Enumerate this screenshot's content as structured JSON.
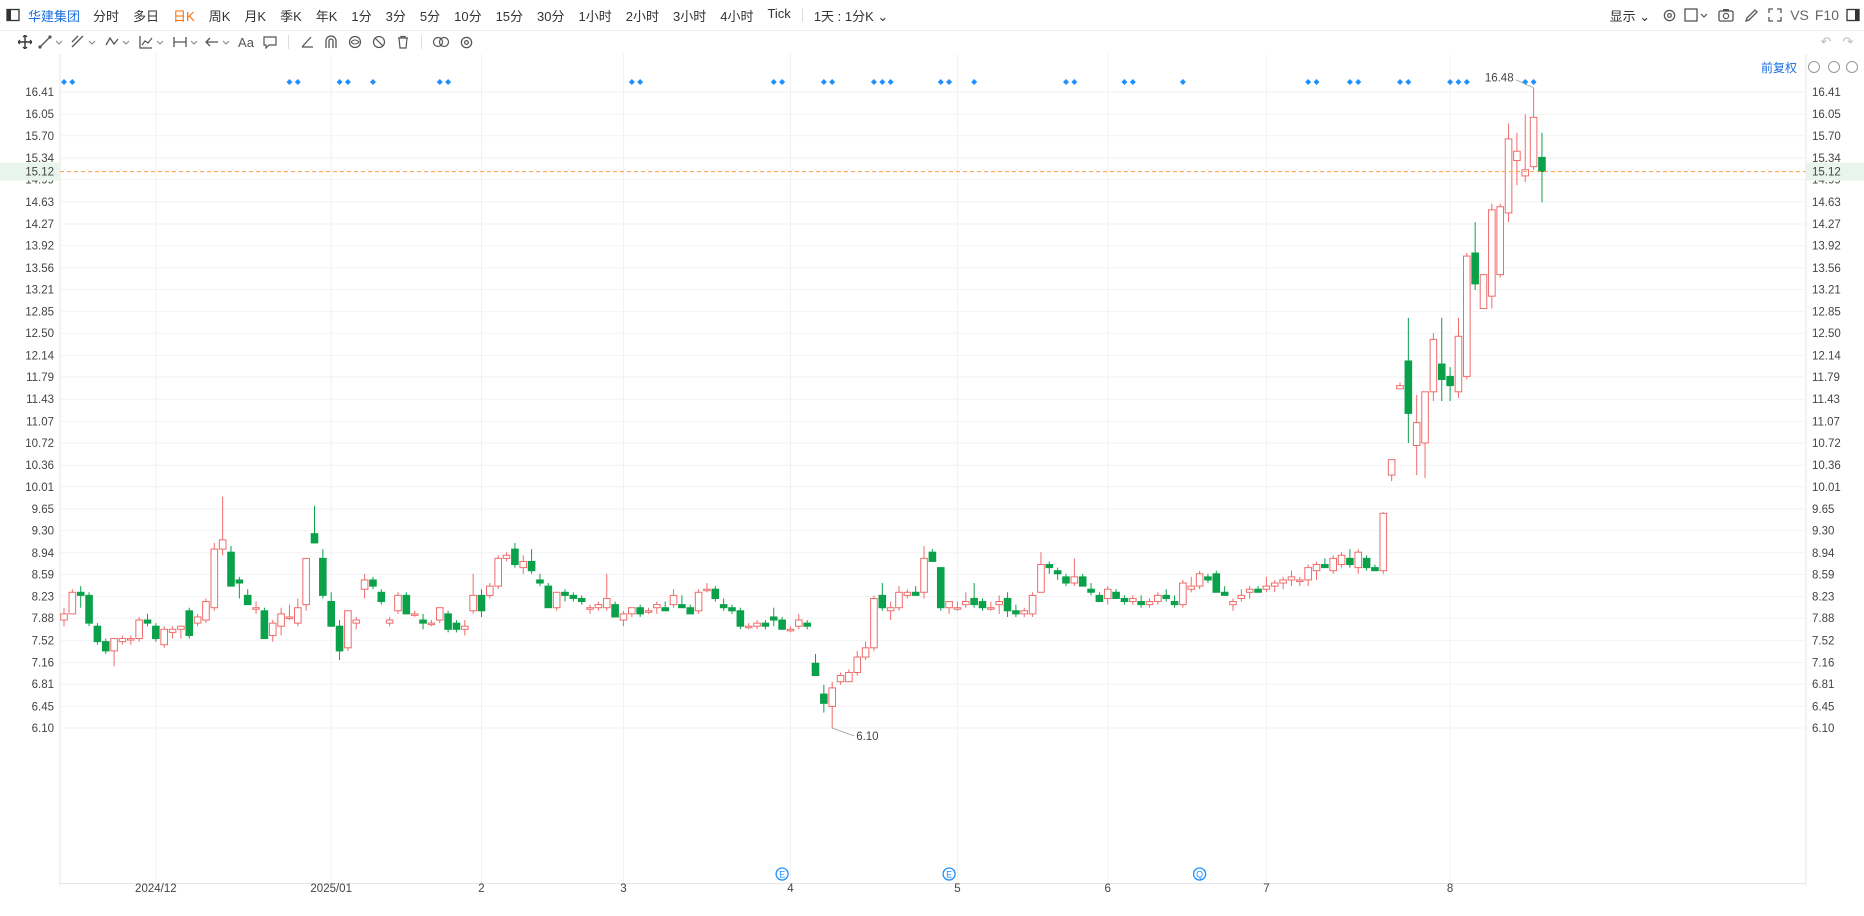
{
  "topbar": {
    "title": "华建集团",
    "periods": [
      "分时",
      "多日",
      "日K",
      "周K",
      "月K",
      "季K",
      "年K",
      "1分",
      "3分",
      "5分",
      "10分",
      "15分",
      "30分",
      "1小时",
      "2小时",
      "3小时",
      "4小时",
      "Tick"
    ],
    "active_period": "日K",
    "interval_label": "1天 : 1分K",
    "display_label": "显示",
    "vs_label": "VS",
    "f10_label": "F10"
  },
  "toolbar": {
    "text_tool_label": "Aa",
    "adjust_label": "前复权"
  },
  "colors": {
    "up": "#f06b6b",
    "down": "#0aa14b",
    "marker": "#1e90ff",
    "current_price_bg": "#e8f5ec",
    "current_price_line": "#ff9f40",
    "accent": "#1b6fe0",
    "active_tab": "#ff6a00"
  },
  "chart_data": {
    "type": "candlestick",
    "price_ticks": [
      6.1,
      6.45,
      6.81,
      7.16,
      7.52,
      7.88,
      8.23,
      8.59,
      8.94,
      9.3,
      9.65,
      10.01,
      10.36,
      10.72,
      11.07,
      11.43,
      11.79,
      12.14,
      12.5,
      12.85,
      13.21,
      13.56,
      13.92,
      14.27,
      14.63,
      14.99,
      15.34,
      15.7,
      16.05,
      16.41
    ],
    "ylim": [
      5.94,
      16.76
    ],
    "current_price": "15.12",
    "high_label": "16.48",
    "low_label": "6.10",
    "x_labels": [
      {
        "label": "2024/12",
        "index": 11
      },
      {
        "label": "2025/01",
        "index": 32
      },
      {
        "label": "2",
        "index": 50
      },
      {
        "label": "3",
        "index": 67
      },
      {
        "label": "4",
        "index": 87
      },
      {
        "label": "5",
        "index": 107
      },
      {
        "label": "6",
        "index": 125
      },
      {
        "label": "7",
        "index": 144
      },
      {
        "label": "8",
        "index": 166
      }
    ],
    "event_markers": [
      {
        "label": "E",
        "index": 86
      },
      {
        "label": "E",
        "index": 106
      },
      {
        "label": "Q",
        "index": 136
      }
    ],
    "ohlc": [
      [
        7.85,
        8.05,
        7.75,
        7.95
      ],
      [
        7.95,
        8.35,
        7.95,
        8.3
      ],
      [
        8.3,
        8.4,
        8.05,
        8.25
      ],
      [
        8.25,
        8.3,
        7.75,
        7.8
      ],
      [
        7.75,
        7.8,
        7.45,
        7.5
      ],
      [
        7.5,
        7.55,
        7.3,
        7.35
      ],
      [
        7.35,
        7.55,
        7.1,
        7.55
      ],
      [
        7.5,
        7.6,
        7.45,
        7.55
      ],
      [
        7.55,
        7.6,
        7.45,
        7.55
      ],
      [
        7.55,
        7.9,
        7.5,
        7.85
      ],
      [
        7.85,
        7.95,
        7.75,
        7.8
      ],
      [
        7.75,
        7.8,
        7.5,
        7.55
      ],
      [
        7.45,
        7.75,
        7.4,
        7.7
      ],
      [
        7.65,
        7.75,
        7.55,
        7.7
      ],
      [
        7.7,
        7.75,
        7.55,
        7.75
      ],
      [
        8.0,
        8.05,
        7.55,
        7.6
      ],
      [
        7.8,
        7.95,
        7.75,
        7.9
      ],
      [
        7.85,
        8.2,
        7.8,
        8.15
      ],
      [
        8.05,
        9.1,
        8.0,
        9.0
      ],
      [
        9.0,
        9.85,
        8.9,
        9.15
      ],
      [
        8.95,
        9.05,
        8.4,
        8.4
      ],
      [
        8.5,
        8.55,
        8.2,
        8.45
      ],
      [
        8.25,
        8.35,
        8.1,
        8.1
      ],
      [
        8.05,
        8.15,
        7.95,
        8.05
      ],
      [
        8.0,
        8.05,
        7.55,
        7.55
      ],
      [
        7.6,
        7.85,
        7.5,
        7.8
      ],
      [
        7.75,
        8.05,
        7.6,
        7.95
      ],
      [
        7.9,
        8.1,
        7.85,
        7.9
      ],
      [
        7.8,
        8.2,
        7.75,
        8.05
      ],
      [
        8.1,
        8.85,
        8.0,
        8.85
      ],
      [
        9.25,
        9.7,
        9.1,
        9.1
      ],
      [
        8.85,
        9.0,
        8.2,
        8.25
      ],
      [
        8.15,
        8.3,
        7.75,
        7.75
      ],
      [
        7.75,
        7.85,
        7.2,
        7.35
      ],
      [
        7.4,
        8.0,
        7.35,
        8.0
      ],
      [
        7.8,
        7.9,
        7.7,
        7.85
      ],
      [
        8.35,
        8.6,
        8.2,
        8.5
      ],
      [
        8.5,
        8.55,
        8.35,
        8.4
      ],
      [
        8.3,
        8.35,
        8.1,
        8.15
      ],
      [
        7.8,
        7.9,
        7.75,
        7.85
      ],
      [
        8.0,
        8.3,
        7.95,
        8.25
      ],
      [
        8.25,
        8.3,
        7.95,
        7.95
      ],
      [
        7.95,
        8.0,
        7.9,
        7.95
      ],
      [
        7.85,
        7.95,
        7.7,
        7.8
      ],
      [
        7.8,
        7.85,
        7.75,
        7.8
      ],
      [
        7.85,
        8.05,
        7.8,
        8.05
      ],
      [
        7.95,
        8.0,
        7.65,
        7.7
      ],
      [
        7.8,
        7.85,
        7.65,
        7.7
      ],
      [
        7.7,
        7.85,
        7.6,
        7.75
      ],
      [
        8.0,
        8.6,
        7.95,
        8.25
      ],
      [
        8.25,
        8.35,
        7.9,
        8.0
      ],
      [
        8.25,
        8.45,
        8.2,
        8.4
      ],
      [
        8.4,
        8.9,
        8.35,
        8.85
      ],
      [
        8.85,
        8.95,
        8.8,
        8.9
      ],
      [
        9.0,
        9.1,
        8.7,
        8.75
      ],
      [
        8.7,
        8.9,
        8.6,
        8.8
      ],
      [
        8.8,
        9.0,
        8.6,
        8.65
      ],
      [
        8.5,
        8.6,
        8.4,
        8.45
      ],
      [
        8.4,
        8.45,
        8.05,
        8.05
      ],
      [
        8.05,
        8.3,
        8.0,
        8.3
      ],
      [
        8.3,
        8.35,
        8.15,
        8.25
      ],
      [
        8.25,
        8.3,
        8.15,
        8.2
      ],
      [
        8.2,
        8.25,
        8.1,
        8.15
      ],
      [
        8.05,
        8.1,
        7.95,
        8.05
      ],
      [
        8.05,
        8.15,
        8.0,
        8.1
      ],
      [
        8.05,
        8.6,
        8.0,
        8.2
      ],
      [
        8.1,
        8.15,
        7.9,
        7.9
      ],
      [
        7.85,
        8.0,
        7.75,
        7.95
      ],
      [
        7.95,
        8.05,
        7.9,
        8.05
      ],
      [
        8.05,
        8.1,
        7.9,
        7.95
      ],
      [
        8.0,
        8.05,
        7.95,
        8.0
      ],
      [
        8.05,
        8.15,
        7.95,
        8.1
      ],
      [
        8.05,
        8.15,
        8.0,
        8.0
      ],
      [
        8.1,
        8.35,
        8.05,
        8.25
      ],
      [
        8.1,
        8.25,
        8.05,
        8.05
      ],
      [
        8.05,
        8.1,
        7.95,
        7.95
      ],
      [
        8.0,
        8.35,
        7.95,
        8.3
      ],
      [
        8.35,
        8.45,
        8.3,
        8.35
      ],
      [
        8.35,
        8.4,
        8.15,
        8.2
      ],
      [
        8.1,
        8.2,
        8.0,
        8.05
      ],
      [
        8.05,
        8.1,
        7.95,
        8.0
      ],
      [
        8.0,
        8.05,
        7.7,
        7.75
      ],
      [
        7.75,
        7.8,
        7.7,
        7.75
      ],
      [
        7.75,
        7.85,
        7.7,
        7.8
      ],
      [
        7.8,
        7.85,
        7.7,
        7.75
      ],
      [
        7.9,
        8.05,
        7.75,
        7.85
      ],
      [
        7.85,
        7.9,
        7.7,
        7.7
      ],
      [
        7.7,
        7.75,
        7.65,
        7.7
      ],
      [
        7.75,
        7.95,
        7.7,
        7.85
      ],
      [
        7.8,
        7.85,
        7.7,
        7.75
      ],
      [
        7.15,
        7.3,
        6.95,
        6.95
      ],
      [
        6.65,
        6.8,
        6.35,
        6.5
      ],
      [
        6.45,
        6.85,
        6.1,
        6.75
      ],
      [
        6.85,
        7.0,
        6.8,
        6.95
      ],
      [
        6.85,
        7.05,
        6.85,
        7.0
      ],
      [
        7.0,
        7.35,
        6.95,
        7.25
      ],
      [
        7.25,
        7.5,
        7.2,
        7.4
      ],
      [
        7.4,
        8.25,
        7.35,
        8.2
      ],
      [
        8.25,
        8.45,
        8.0,
        8.05
      ],
      [
        8.0,
        8.15,
        7.85,
        8.05
      ],
      [
        8.05,
        8.4,
        8.0,
        8.3
      ],
      [
        8.25,
        8.35,
        8.2,
        8.3
      ],
      [
        8.3,
        8.4,
        8.25,
        8.25
      ],
      [
        8.3,
        9.05,
        8.2,
        8.85
      ],
      [
        8.95,
        9.0,
        8.8,
        8.8
      ],
      [
        8.7,
        8.7,
        8.0,
        8.05
      ],
      [
        8.05,
        8.15,
        7.95,
        8.15
      ],
      [
        8.05,
        8.15,
        8.0,
        8.05
      ],
      [
        8.1,
        8.3,
        8.05,
        8.15
      ],
      [
        8.2,
        8.45,
        8.05,
        8.1
      ],
      [
        8.15,
        8.2,
        8.0,
        8.05
      ],
      [
        8.05,
        8.15,
        8.0,
        8.05
      ],
      [
        8.1,
        8.25,
        7.95,
        8.15
      ],
      [
        8.2,
        8.3,
        7.9,
        8.0
      ],
      [
        8.0,
        8.1,
        7.9,
        7.95
      ],
      [
        7.95,
        8.05,
        7.9,
        8.0
      ],
      [
        7.95,
        8.3,
        7.9,
        8.25
      ],
      [
        8.3,
        8.95,
        8.3,
        8.75
      ],
      [
        8.75,
        8.8,
        8.6,
        8.7
      ],
      [
        8.65,
        8.7,
        8.5,
        8.6
      ],
      [
        8.55,
        8.6,
        8.4,
        8.45
      ],
      [
        8.45,
        8.85,
        8.4,
        8.55
      ],
      [
        8.55,
        8.6,
        8.4,
        8.4
      ],
      [
        8.35,
        8.45,
        8.25,
        8.3
      ],
      [
        8.25,
        8.3,
        8.15,
        8.15
      ],
      [
        8.2,
        8.4,
        8.1,
        8.35
      ],
      [
        8.3,
        8.35,
        8.2,
        8.2
      ],
      [
        8.2,
        8.25,
        8.1,
        8.15
      ],
      [
        8.15,
        8.25,
        8.1,
        8.2
      ],
      [
        8.15,
        8.25,
        8.05,
        8.1
      ],
      [
        8.1,
        8.2,
        8.05,
        8.15
      ],
      [
        8.15,
        8.3,
        8.1,
        8.25
      ],
      [
        8.25,
        8.35,
        8.15,
        8.2
      ],
      [
        8.15,
        8.25,
        8.05,
        8.1
      ],
      [
        8.1,
        8.5,
        8.05,
        8.45
      ],
      [
        8.35,
        8.55,
        8.3,
        8.4
      ],
      [
        8.4,
        8.65,
        8.35,
        8.6
      ],
      [
        8.55,
        8.6,
        8.45,
        8.5
      ],
      [
        8.6,
        8.65,
        8.3,
        8.3
      ],
      [
        8.3,
        8.4,
        8.25,
        8.25
      ],
      [
        8.1,
        8.2,
        8.0,
        8.15
      ],
      [
        8.2,
        8.35,
        8.15,
        8.25
      ],
      [
        8.3,
        8.4,
        8.2,
        8.35
      ],
      [
        8.35,
        8.4,
        8.3,
        8.3
      ],
      [
        8.35,
        8.55,
        8.3,
        8.4
      ],
      [
        8.4,
        8.5,
        8.3,
        8.45
      ],
      [
        8.45,
        8.55,
        8.35,
        8.5
      ],
      [
        8.5,
        8.65,
        8.4,
        8.55
      ],
      [
        8.5,
        8.55,
        8.4,
        8.5
      ],
      [
        8.5,
        8.75,
        8.4,
        8.7
      ],
      [
        8.65,
        8.8,
        8.5,
        8.75
      ],
      [
        8.75,
        8.85,
        8.7,
        8.7
      ],
      [
        8.65,
        8.9,
        8.6,
        8.85
      ],
      [
        8.75,
        8.95,
        8.7,
        8.9
      ],
      [
        8.85,
        9.0,
        8.7,
        8.75
      ],
      [
        8.7,
        9.0,
        8.6,
        8.95
      ],
      [
        8.85,
        8.9,
        8.65,
        8.7
      ],
      [
        8.7,
        8.75,
        8.65,
        8.65
      ],
      [
        8.65,
        9.6,
        8.6,
        9.58
      ],
      [
        10.2,
        10.45,
        10.1,
        10.45
      ],
      [
        11.6,
        11.7,
        11.6,
        11.65
      ],
      [
        12.05,
        12.75,
        10.72,
        11.2
      ],
      [
        10.68,
        11.5,
        10.2,
        11.05
      ],
      [
        10.72,
        11.55,
        10.15,
        11.55
      ],
      [
        11.55,
        12.5,
        11.4,
        12.4
      ],
      [
        12.0,
        12.75,
        11.4,
        11.75
      ],
      [
        11.8,
        11.95,
        11.4,
        11.65
      ],
      [
        11.55,
        12.75,
        11.45,
        12.45
      ],
      [
        11.8,
        13.8,
        11.75,
        13.75
      ],
      [
        13.8,
        14.3,
        13.2,
        13.3
      ],
      [
        12.9,
        13.4,
        12.95,
        13.45
      ],
      [
        13.1,
        14.6,
        12.9,
        14.5
      ],
      [
        13.45,
        14.6,
        13.4,
        14.55
      ],
      [
        14.45,
        15.9,
        14.3,
        15.65
      ],
      [
        15.3,
        15.75,
        14.9,
        15.45
      ],
      [
        15.05,
        16.05,
        14.95,
        15.15
      ],
      [
        15.2,
        16.48,
        15.15,
        16.0
      ],
      [
        15.35,
        15.75,
        14.62,
        15.12
      ]
    ],
    "marker_pairs": [
      [
        0,
        1
      ],
      [
        27,
        28
      ],
      [
        33,
        34
      ],
      [
        37
      ],
      [
        45,
        46
      ],
      [
        68,
        69
      ],
      [
        85,
        86
      ],
      [
        91,
        92
      ],
      [
        97,
        98,
        99
      ],
      [
        105,
        106
      ],
      [
        109
      ],
      [
        120,
        121
      ],
      [
        127,
        128
      ],
      [
        134
      ],
      [
        149,
        150
      ],
      [
        154,
        155
      ],
      [
        160,
        161
      ],
      [
        166,
        167,
        168
      ],
      [
        175,
        176
      ]
    ]
  }
}
